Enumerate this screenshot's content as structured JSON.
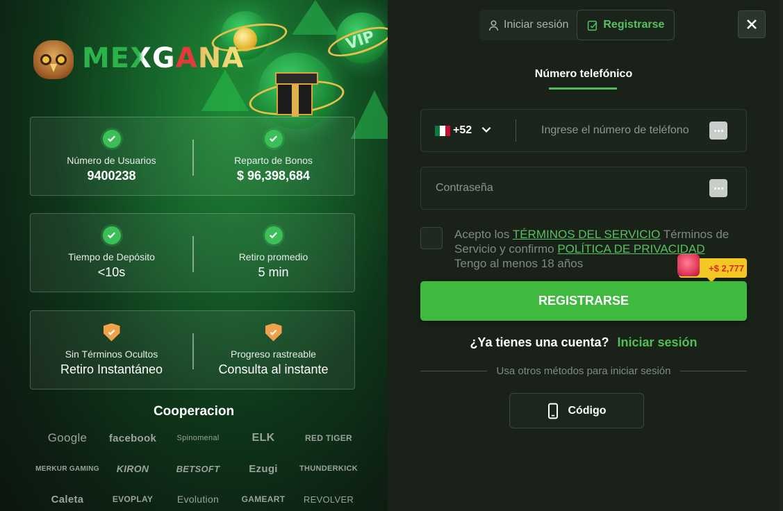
{
  "brand": {
    "name": "MEXGANA"
  },
  "stats": [
    {
      "label": "Número de Usuarios",
      "value": "9400238"
    },
    {
      "label": "Reparto de Bonos",
      "value": "$ 96,398,684"
    },
    {
      "label": "Tiempo de Depósito",
      "value": "<10s"
    },
    {
      "label": "Retiro promedio",
      "value": "5 min"
    },
    {
      "label": "Sin Términos Ocultos",
      "value": "Retiro Instantáneo"
    },
    {
      "label": "Progreso rastreable",
      "value": "Consulta al instante"
    }
  ],
  "cooperation": {
    "title": "Cooperacion",
    "partners": [
      "Google",
      "facebook",
      "Spinomenal",
      "ELK",
      "RED TIGER",
      "MERKUR GAMING",
      "KIRON",
      "BETSOFT",
      "Ezugi",
      "THUNDERKICK",
      "Caleta",
      "EVOPLAY",
      "Evolution",
      "GAMEART",
      "REVOLVER"
    ]
  },
  "tabs": {
    "login": "Iniciar sesión",
    "register": "Registrarse"
  },
  "form": {
    "method_tab": "Número telefónico",
    "country_code": "+52",
    "phone_placeholder": "Ingrese el número de teléfono",
    "password_placeholder": "Contraseña",
    "terms_prefix": "Acepto los",
    "terms_link": "TÉRMINOS DEL SERVICIO",
    "terms_mid": "Términos de Servicio y confirmo",
    "privacy_link": "POLÍTICA DE PRIVACIDAD",
    "terms_suffix": "Tengo al menos 18 años",
    "bonus_badge": "+$ 2,777",
    "submit": "REGISTRARSE",
    "have_account": "¿Ya tienes una cuenta?",
    "login_link": "Iniciar sesión",
    "other_methods": "Usa otros métodos para iniciar sesión",
    "code_button": "Código"
  },
  "colors": {
    "accent": "#3fba3f",
    "link": "#55c160",
    "badge": "#f4c822"
  }
}
